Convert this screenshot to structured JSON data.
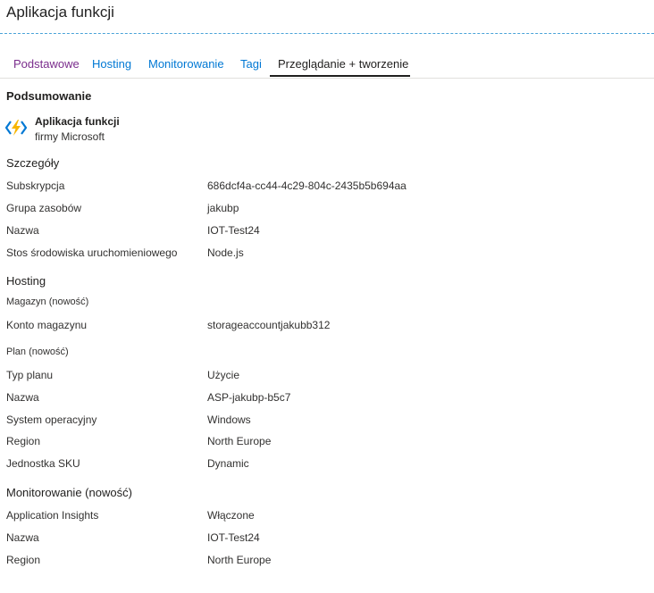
{
  "app": {
    "title": "Aplikacja funkcji"
  },
  "tabs": [
    {
      "label": "Podstawowe"
    },
    {
      "label": "Hosting"
    },
    {
      "label": "Monitorowanie"
    },
    {
      "label": "Tagi"
    },
    {
      "label": "Przeglądanie + tworzenie",
      "active": true
    }
  ],
  "summary": {
    "heading": "Podsumowanie",
    "product_name": "Aplikacja funkcji",
    "publisher": "firmy Microsoft",
    "icon": "function-app-icon"
  },
  "details": {
    "heading": "Szczegóły",
    "rows": [
      {
        "label": "Subskrypcja",
        "value": "686dcf4a-cc44-4c29-804c-2435b5b694aa"
      },
      {
        "label": "Grupa zasobów",
        "value": "jakubp"
      },
      {
        "label": "Nazwa",
        "value": "IOT-Test24"
      },
      {
        "label": "Stos środowiska uruchomieniowego",
        "value": "Node.js"
      }
    ]
  },
  "hosting": {
    "heading": "Hosting",
    "storage_sub": "Magazyn (nowość)",
    "storage_rows": [
      {
        "label": "Konto magazynu",
        "value": "storageaccountjakubb312"
      }
    ],
    "plan_sub": "Plan (nowość)",
    "plan_rows": [
      {
        "label": "Typ planu",
        "value": "Użycie"
      },
      {
        "label": "Nazwa",
        "value": "ASP-jakubp-b5c7"
      },
      {
        "label": "System operacyjny",
        "value": "Windows"
      },
      {
        "label": "Region",
        "value": "North Europe"
      },
      {
        "label": "Jednostka SKU",
        "value": "Dynamic"
      }
    ]
  },
  "monitoring": {
    "heading": "Monitorowanie (nowość)",
    "rows": [
      {
        "label": "Application Insights",
        "value": "Włączone"
      },
      {
        "label": "Nazwa",
        "value": "IOT-Test24"
      },
      {
        "label": "Region",
        "value": "North Europe"
      }
    ]
  },
  "colors": {
    "link": "#0078d4",
    "visited_tab": "#7a2c8c",
    "dashed_line": "#4aa3d8",
    "icon_blue": "#0078d4",
    "icon_yellow": "#f7b500"
  }
}
